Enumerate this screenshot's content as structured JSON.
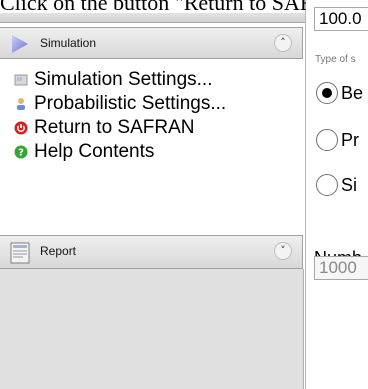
{
  "instruction": "Click on the button \"Return to SAFRAN\"",
  "simulation": {
    "title": "Simulation",
    "items": [
      {
        "label": "Simulation Settings..."
      },
      {
        "label": "Probabilistic Settings..."
      },
      {
        "label": "Return to SAFRAN"
      },
      {
        "label": "Help Contents"
      }
    ]
  },
  "report": {
    "title": "Report"
  },
  "right": {
    "top_value": "100.0",
    "type_label": "Type of s",
    "radios": [
      {
        "label": "Be",
        "checked": true
      },
      {
        "label": "Pr",
        "checked": false
      },
      {
        "label": "Si",
        "checked": false
      }
    ],
    "number_label": "Numb",
    "number_value": "1000"
  },
  "colors": {
    "return_icon": "#d32020",
    "help_icon": "#35a535",
    "sim_icon": "#7a7fd6"
  }
}
